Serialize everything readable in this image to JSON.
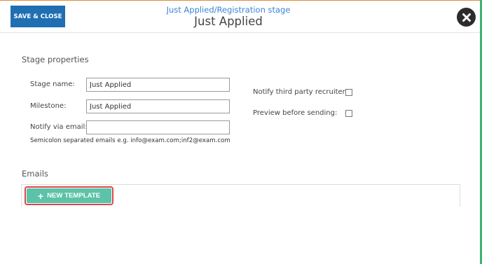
{
  "header": {
    "save_label": "SAVE & CLOSE",
    "breadcrumb": "Just Applied/Registration stage",
    "title": "Just Applied",
    "close_icon": "close-icon"
  },
  "stage_properties": {
    "heading": "Stage properties",
    "stage_name": {
      "label": "Stage name:",
      "value": "Just Applied"
    },
    "milestone": {
      "label": "Milestone:",
      "value": "Just Applied"
    },
    "notify_email": {
      "label": "Notify via email:",
      "value": ""
    },
    "email_hint": "Semicolon separated emails e.g. info@exam.com;inf2@exam.com",
    "notify_recruiter": {
      "label": "Notify third party recruiter:",
      "checked": false
    },
    "preview_before_sending": {
      "label": "Preview before sending:",
      "checked": false
    }
  },
  "emails": {
    "heading": "Emails",
    "new_template_label": "NEW TEMPLATE",
    "new_template_icon": "plus-icon"
  },
  "colors": {
    "save_button": "#1f6fb2",
    "breadcrumb": "#3a86d4",
    "new_template_button": "#5cc2a8",
    "highlight": "#d94848",
    "right_edge": "#3cb371"
  }
}
